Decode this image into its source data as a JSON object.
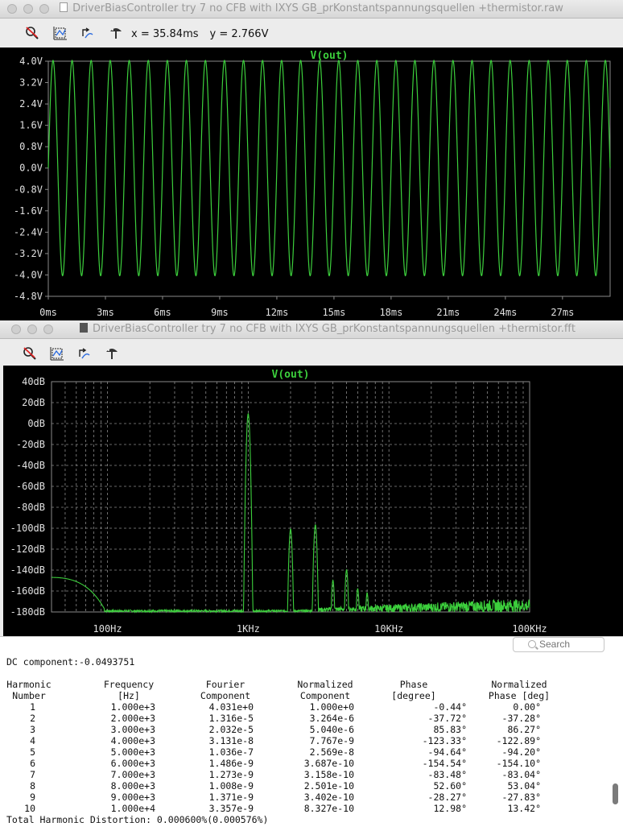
{
  "window1": {
    "title": "DriverBiasController try 7 no CFB with IXYS GB_prKonstantspannungsquellen +thermistor.raw",
    "cursor_x": "x = 35.84ms",
    "cursor_y": "y = 2.766V"
  },
  "window2": {
    "title": "DriverBiasController try 7 no CFB with IXYS GB_prKonstantspannungsquellen +thermistor.fft"
  },
  "toolbar_icons": [
    "zoom-cancel-icon",
    "autorange-icon",
    "pan-icon",
    "probe-icon"
  ],
  "colors": {
    "trace": "#3ccf3c",
    "grid": "#8a8a8a",
    "axis_text": "#e0e0e0"
  },
  "chart_data": [
    {
      "type": "line",
      "title": "V(out)",
      "xlabel": "",
      "ylabel": "",
      "x_ticks": [
        "0ms",
        "3ms",
        "6ms",
        "9ms",
        "12ms",
        "15ms",
        "18ms",
        "21ms",
        "24ms",
        "27ms"
      ],
      "y_ticks": [
        "4.0V",
        "3.2V",
        "2.4V",
        "1.6V",
        "0.8V",
        "0.0V",
        "-0.8V",
        "-1.6V",
        "-2.4V",
        "-3.2V",
        "-4.0V",
        "-4.8V"
      ],
      "xlim": [
        0,
        29.5
      ],
      "ylim": [
        -4.8,
        4.0
      ],
      "series": [
        {
          "name": "V(out)",
          "frequency_khz": 1.0,
          "amplitude": 4.03,
          "offset": 0.0
        }
      ],
      "grid": false
    },
    {
      "type": "line",
      "title": "V(out)",
      "xlabel": "",
      "ylabel": "",
      "x_scale": "log",
      "x_ticks": [
        "100Hz",
        "1KHz",
        "10KHz",
        "100KHz"
      ],
      "y_ticks": [
        "40dB",
        "20dB",
        "0dB",
        "-20dB",
        "-40dB",
        "-60dB",
        "-80dB",
        "-100dB",
        "-120dB",
        "-140dB",
        "-160dB",
        "-180dB"
      ],
      "xlim": [
        40,
        100000
      ],
      "ylim": [
        -180,
        40
      ],
      "grid": true,
      "series": [
        {
          "name": "V(out)",
          "peaks": [
            {
              "x": 1000,
              "y": 9
            },
            {
              "x": 2000,
              "y": -101
            },
            {
              "x": 3000,
              "y": -97
            },
            {
              "x": 4000,
              "y": -150
            },
            {
              "x": 5000,
              "y": -140
            },
            {
              "x": 6000,
              "y": -158
            },
            {
              "x": 7000,
              "y": -162
            }
          ]
        }
      ]
    }
  ],
  "fourier": {
    "search_placeholder": "Search",
    "dc": "DC component:-0.0493751",
    "headers1": [
      "Harmonic",
      "Frequency",
      "Fourier",
      "Normalized",
      "Phase",
      "Normalized"
    ],
    "headers2": [
      "Number",
      "[Hz]",
      "Component",
      "Component",
      "[degree]",
      "Phase [deg]"
    ],
    "rows": [
      [
        "1",
        "1.000e+3",
        "4.031e+0",
        "1.000e+0",
        "-0.44°",
        "0.00°"
      ],
      [
        "2",
        "2.000e+3",
        "1.316e-5",
        "3.264e-6",
        "-37.72°",
        "-37.28°"
      ],
      [
        "3",
        "3.000e+3",
        "2.032e-5",
        "5.040e-6",
        "85.83°",
        "86.27°"
      ],
      [
        "4",
        "4.000e+3",
        "3.131e-8",
        "7.767e-9",
        "-123.33°",
        "-122.89°"
      ],
      [
        "5",
        "5.000e+3",
        "1.036e-7",
        "2.569e-8",
        "-94.64°",
        "-94.20°"
      ],
      [
        "6",
        "6.000e+3",
        "1.486e-9",
        "3.687e-10",
        "-154.54°",
        "-154.10°"
      ],
      [
        "7",
        "7.000e+3",
        "1.273e-9",
        "3.158e-10",
        "-83.48°",
        "-83.04°"
      ],
      [
        "8",
        "8.000e+3",
        "1.008e-9",
        "2.501e-10",
        "52.60°",
        "53.04°"
      ],
      [
        "9",
        "9.000e+3",
        "1.371e-9",
        "3.402e-10",
        "-28.27°",
        "-27.83°"
      ],
      [
        "10",
        "1.000e+4",
        "3.357e-9",
        "8.327e-10",
        "12.98°",
        "13.42°"
      ]
    ],
    "thd": "Total Harmonic Distortion: 0.000600%(0.000576%)"
  }
}
